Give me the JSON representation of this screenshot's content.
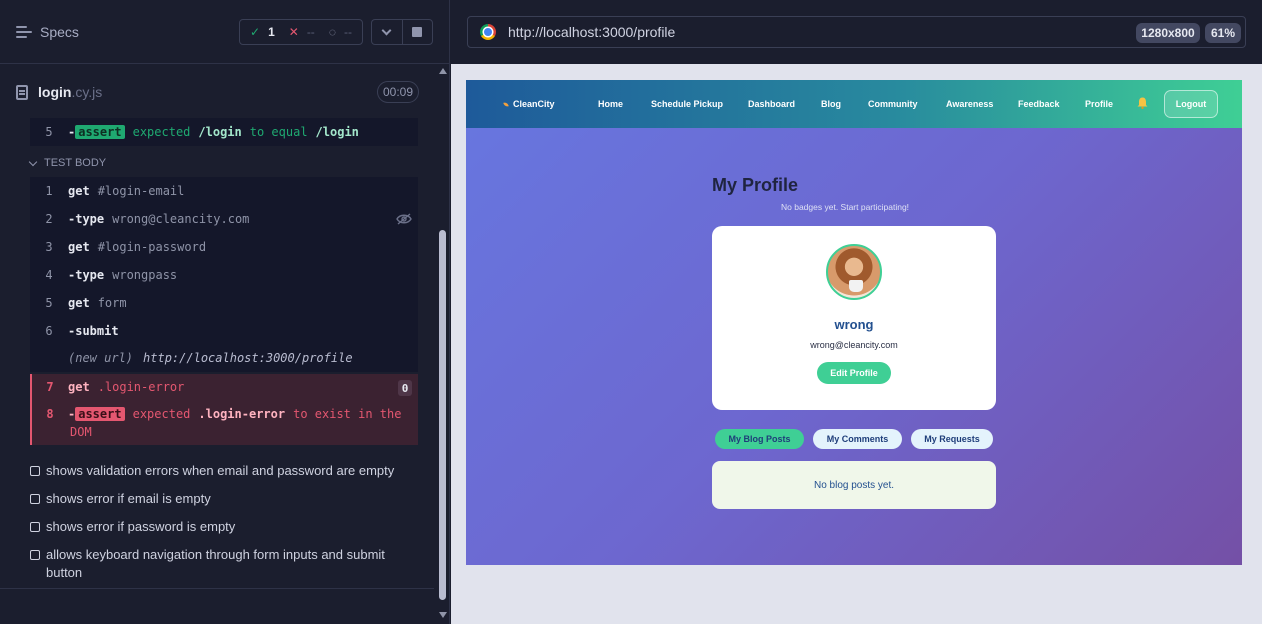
{
  "reporter": {
    "specs_label": "Specs",
    "stats": {
      "passed_icon": "✓",
      "passed": "1",
      "failed_icon": "✕",
      "failed": "--",
      "pending_icon": "◌",
      "pending": "--"
    },
    "spec_name": "login",
    "spec_ext": ".cy.js",
    "timer": "00:09",
    "assert_prev": {
      "num": "5",
      "prefix": "-",
      "badge": "assert",
      "expected": "expected",
      "value": "/login",
      "to_equal": "to equal",
      "target": "/login"
    },
    "test_body_label": "TEST BODY",
    "commands": [
      {
        "num": "1",
        "name": "get",
        "arg": "#login-email"
      },
      {
        "num": "2",
        "name": "-type",
        "arg": "wrong@cleancity.com"
      },
      {
        "num": "3",
        "name": "get",
        "arg": "#login-password"
      },
      {
        "num": "4",
        "name": "-type",
        "arg": "wrongpass"
      },
      {
        "num": "5",
        "name": "get",
        "arg": "form"
      },
      {
        "num": "6",
        "name": "-submit",
        "arg": ""
      }
    ],
    "new_url": {
      "label": "(new url)",
      "url": "http://localhost:3000/profile"
    },
    "failed": {
      "cmd7": {
        "num": "7",
        "name": "get",
        "arg": ".login-error",
        "count": "0"
      },
      "cmd8": {
        "num": "8",
        "prefix": "-",
        "badge": "assert",
        "expected": "expected",
        "value": ".login-error",
        "rest": "to exist in the",
        "wrap": "DOM"
      }
    },
    "tests": [
      "shows validation errors when email and password are empty",
      "shows error if email is empty",
      "shows error if password is empty",
      "allows keyboard navigation through form inputs and submit button"
    ]
  },
  "browser": {
    "url": "http://localhost:3000/profile",
    "viewport": "1280x800",
    "zoom": "61%"
  },
  "site": {
    "logo": "CleanCity",
    "nav": [
      "Home",
      "Schedule Pickup",
      "Dashboard",
      "Blog",
      "Community",
      "Awareness",
      "Feedback",
      "Profile"
    ],
    "logout": "Logout",
    "title": "My Profile",
    "subtitle": "No badges yet. Start participating!",
    "user": {
      "name": "wrong",
      "email": "wrong@cleancity.com"
    },
    "edit_profile": "Edit Profile",
    "tabs": [
      "My Blog Posts",
      "My Comments",
      "My Requests"
    ],
    "empty_message": "No blog posts yet."
  },
  "colors": {
    "pass": "#1fa971",
    "fail": "#e45770",
    "accent": "#3fcf95",
    "nav_start": "#1e5a9a",
    "nav_end": "#3fcf95"
  },
  "icons": [
    "menu-icon",
    "check-icon",
    "x-icon",
    "pending-icon",
    "chevron-down-icon",
    "stop-icon",
    "file-icon",
    "eye-slash-icon",
    "chrome-icon",
    "bell-icon",
    "leaf-icon"
  ]
}
